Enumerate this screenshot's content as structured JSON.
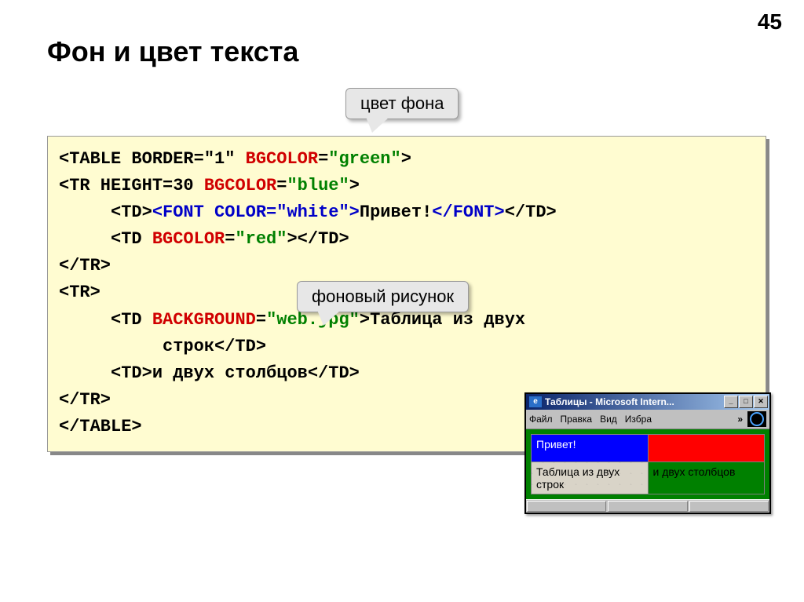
{
  "page_number": "45",
  "title": "Фон и цвет текста",
  "callouts": {
    "bgcolor": "цвет фона",
    "background": "фоновый рисунок"
  },
  "code": {
    "l1": {
      "a": "<TABLE BORDER=\"1\" ",
      "b": "BGCOLOR",
      "c": "=",
      "d": "\"green\"",
      "e": ">"
    },
    "l2": {
      "a": "<TR HEIGHT=30 ",
      "b": "BGCOLOR",
      "c": "=",
      "d": "\"blue\"",
      "e": ">"
    },
    "l3": {
      "a": "     <TD>",
      "b": "<FONT COLOR=\"white\">",
      "c": "Привет!",
      "d": "</FONT>",
      "e": "</TD>"
    },
    "l4": {
      "a": "     <TD ",
      "b": "BGCOLOR",
      "c": "=",
      "d": "\"red\"",
      "e": "></TD>"
    },
    "l5": "</TR>",
    "l6": "<TR>",
    "l7": {
      "a": "     <TD ",
      "b": "BACKGROUND",
      "c": "=",
      "d": "\"web.jpg\"",
      "e": ">Таблица из двух"
    },
    "l8": "          строк</TD>",
    "l9": "     <TD>и двух столбцов</TD>",
    "l10": "</TR>",
    "l11": "</TABLE>"
  },
  "browser": {
    "title": "Таблицы - Microsoft Intern...",
    "menu": {
      "file": "Файл",
      "edit": "Правка",
      "view": "Вид",
      "fav": "Избра"
    },
    "cells": {
      "blue": "Привет!",
      "webbg": "Таблица из двух строк",
      "green": "и двух столбцов"
    }
  }
}
